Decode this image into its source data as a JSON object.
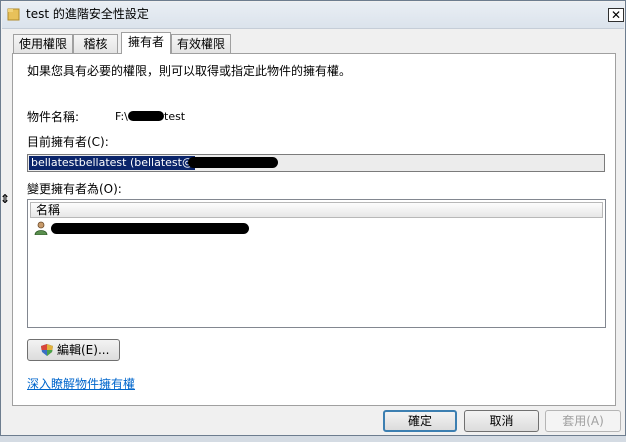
{
  "window": {
    "title": "test 的進階安全性設定",
    "close_label": "✕"
  },
  "tabs": [
    {
      "label": "使用權限",
      "active": false
    },
    {
      "label": "稽核",
      "active": false
    },
    {
      "label": "擁有者",
      "active": true
    },
    {
      "label": "有效權限",
      "active": false
    }
  ],
  "owner_page": {
    "description": "如果您具有必要的權限，則可以取得或指定此物件的擁有權。",
    "object_name_label": "物件名稱:",
    "object_name_prefix": "F:\\",
    "object_name_suffix": "test",
    "current_owner_label": "目前擁有者(C):",
    "current_owner_value": "bellatestbellatest (bellatest@",
    "change_owner_label": "變更擁有者為(O):",
    "list_header": "名稱",
    "edit_button": "編輯(E)...",
    "learn_more_link": "深入瞭解物件擁有權"
  },
  "footer": {
    "ok": "確定",
    "cancel": "取消",
    "apply": "套用(A)"
  },
  "colors": {
    "selection": "#0a246a",
    "link": "#0066cc",
    "default_button_border": "#3c7fb1"
  }
}
